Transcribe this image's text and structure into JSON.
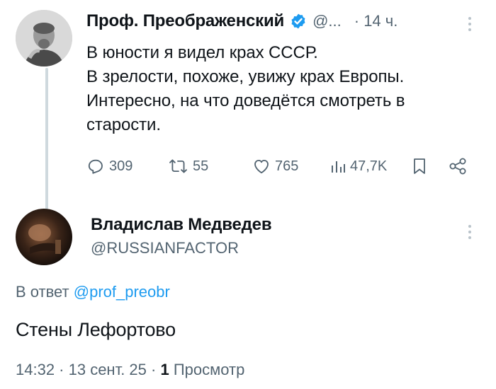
{
  "parent_tweet": {
    "display_name": "Проф. Преображенский",
    "handle": "@...",
    "time": "· 14 ч.",
    "text_lines": [
      "В юности я видел крах СССР.",
      "В зрелости, похоже, увижу крах Европы.",
      "Интересно, на что доведётся смотреть в",
      "старости."
    ],
    "actions": {
      "replies": "309",
      "reposts": "55",
      "likes": "765",
      "views": "47,7K"
    },
    "verified_color": "#1d9bf0"
  },
  "reply_tweet": {
    "display_name": "Владислав Медведев",
    "handle": "@RUSSIANFACTOR",
    "reply_prefix": "В ответ",
    "reply_to": "@prof_preobr",
    "text": "Стены Лефортово",
    "timestamp": "14:32 · 13 сент. 25 ·",
    "views_count": "1",
    "views_label": "Просмотр"
  },
  "colors": {
    "link": "#1d9bf0",
    "muted": "#536471",
    "text": "#0f1419"
  }
}
